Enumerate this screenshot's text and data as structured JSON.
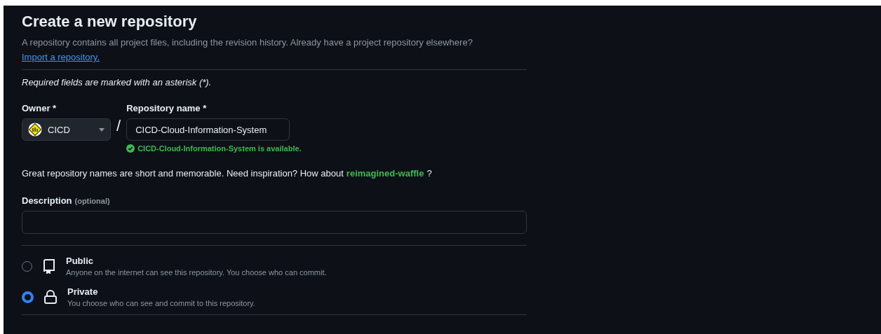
{
  "title": "Create a new repository",
  "intro": "A repository contains all project files, including the revision history. Already have a project repository elsewhere?",
  "import_link": "Import a repository.",
  "required_note": "Required fields are marked with an asterisk (*).",
  "owner": {
    "label": "Owner *",
    "value": "CICD"
  },
  "separator": "/",
  "repo_name": {
    "label": "Repository name *",
    "value": "CICD-Cloud-Information-System",
    "status": "CICD-Cloud-Information-System is available."
  },
  "suggestion": {
    "text": "Great repository names are short and memorable. Need inspiration? How about",
    "name": "reimagined-waffle",
    "end": "?"
  },
  "description": {
    "label": "Description",
    "hint": "(optional)"
  },
  "visibility": [
    {
      "kind": "public",
      "title": "Public",
      "text": "Anyone on the internet can see this repository. You choose who can commit.",
      "selected": false
    },
    {
      "kind": "private",
      "title": "Private",
      "text": "You choose who can see and commit to this repository.",
      "selected": true
    }
  ]
}
